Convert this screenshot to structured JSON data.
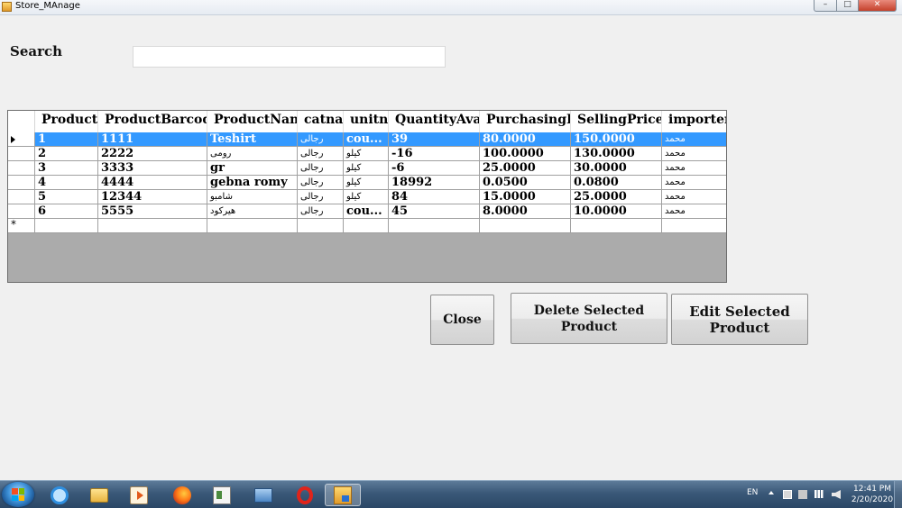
{
  "window": {
    "title": "Store_MAnage",
    "minimize_glyph": "–",
    "maximize_glyph": "□",
    "close_glyph": "✕"
  },
  "search": {
    "label": "Search",
    "value": "",
    "placeholder": ""
  },
  "grid": {
    "columns": [
      "ProductId",
      "ProductBarcode",
      "ProductName",
      "catname",
      "unitname",
      "QuantityAvailable",
      "PurchasingPrice",
      "SellingPrice",
      "importer"
    ],
    "rows": [
      [
        "1",
        "1111",
        "Teshirt",
        "رجالى",
        "cou...",
        "39",
        "80.0000",
        "150.0000",
        "محمد"
      ],
      [
        "2",
        "2222",
        "رومى",
        "رجالى",
        "كيلو",
        "-16",
        "100.0000",
        "130.0000",
        "محمد"
      ],
      [
        "3",
        "3333",
        "gr",
        "رجالى",
        "كيلو",
        "-6",
        "25.0000",
        "30.0000",
        "محمد"
      ],
      [
        "4",
        "4444",
        "gebna romy",
        "رجالى",
        "كيلو",
        "18992",
        "0.0500",
        "0.0800",
        "محمد"
      ],
      [
        "5",
        "12344",
        "شامبو",
        "رجالى",
        "كيلو",
        "84",
        "15.0000",
        "25.0000",
        "محمد"
      ],
      [
        "6",
        "5555",
        "هيركود",
        "رجالى",
        "cou...",
        "45",
        "8.0000",
        "10.0000",
        "محمد"
      ]
    ],
    "selected_row": 0,
    "new_row_marker": "*"
  },
  "buttons": {
    "close": "Close",
    "delete": "Delete Selected Product",
    "edit": "Edit Selected Product"
  },
  "taskbar": {
    "language": "EN",
    "time": "12:41 PM",
    "date": "2/20/2020",
    "apps": [
      "internet-explorer",
      "file-explorer",
      "media-player",
      "firefox",
      "visual-studio-form",
      "remote-desktop",
      "opera",
      "store-manage"
    ]
  }
}
